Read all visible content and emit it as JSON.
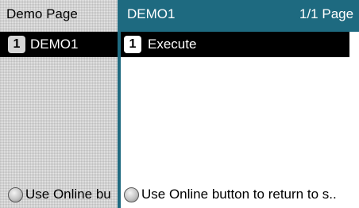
{
  "left_panel": {
    "header": "Demo Page",
    "items": [
      {
        "number": "1",
        "label": "DEMO1"
      }
    ],
    "footer": {
      "icon": "online-button-icon",
      "text": "Use Online bu"
    }
  },
  "right_panel": {
    "header": {
      "title": "DEMO1",
      "page_indicator": "1/1 Page"
    },
    "items": [
      {
        "number": "1",
        "label": "Execute"
      }
    ],
    "footer": {
      "icon": "online-button-icon",
      "text": "Use Online button to return to s.."
    }
  },
  "colors": {
    "header_bar": "#1e6a80",
    "selected_row": "#000000",
    "selected_text": "#ffffff",
    "left_background": "#e6e6e6"
  }
}
